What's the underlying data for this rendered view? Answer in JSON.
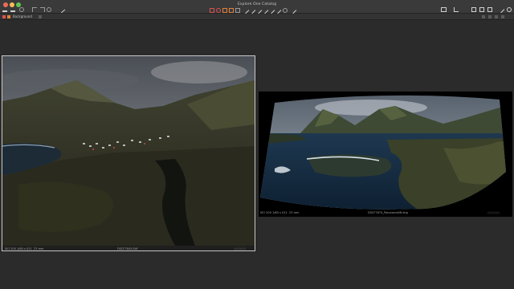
{
  "window": {
    "title": "Explore One Catalog"
  },
  "layers": {
    "current": "Background"
  },
  "viewers": [
    {
      "filename": "DSCF7843.RAF",
      "meta": {
        "iso": "ISO 200",
        "shutter": "1/60 s",
        "aperture": "f/11",
        "focal": "23 mm"
      }
    },
    {
      "filename": "DSCF7874_Panorama08.dng",
      "meta": {
        "iso": "ISO 200",
        "shutter": "1/60 s",
        "aperture": "f/11",
        "focal": "23 mm"
      }
    }
  ],
  "colors": {
    "toolbar": "#3a3a3a",
    "background": "#2b2b2b",
    "selection_border": "#c8c8c8",
    "accent_red": "#d9534f",
    "accent_orange": "#e0823a"
  }
}
